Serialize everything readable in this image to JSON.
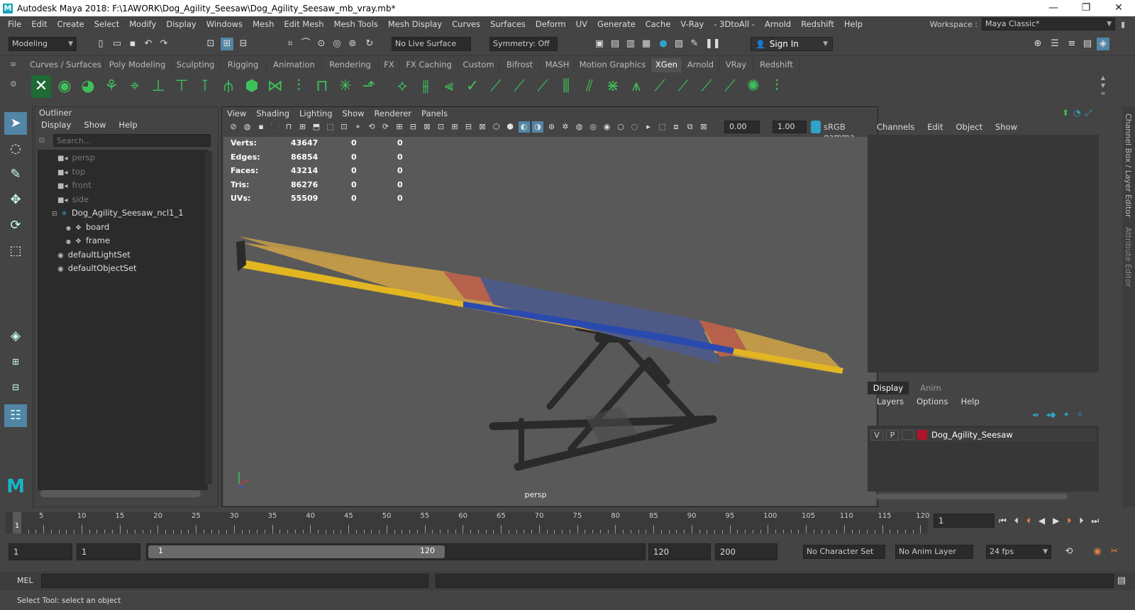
{
  "window": {
    "title": "Autodesk Maya 2018: F:\\1AWORK\\Dog_Agility_Seesaw\\Dog_Agility_Seesaw_mb_vray.mb*",
    "logo": "M",
    "minimize": "—",
    "restore": "❐",
    "close": "✕"
  },
  "menubar": {
    "items": [
      "File",
      "Edit",
      "Create",
      "Select",
      "Modify",
      "Display",
      "Windows",
      "Mesh",
      "Edit Mesh",
      "Mesh Tools",
      "Mesh Display",
      "Curves",
      "Surfaces",
      "Deform",
      "UV",
      "Generate",
      "Cache",
      "V-Ray",
      "- 3DtoAll -",
      "Arnold",
      "Redshift",
      "Help"
    ],
    "workspace_label": "Workspace :",
    "workspace_value": "Maya Classic*"
  },
  "toolbar": {
    "mode": "Modeling",
    "live_surface": "No Live Surface",
    "symmetry": "Symmetry: Off",
    "sign_in": "Sign In"
  },
  "shelf_tabs": [
    "Curves / Surfaces",
    "Poly Modeling",
    "Sculpting",
    "Rigging",
    "Animation",
    "Rendering",
    "FX",
    "FX Caching",
    "Custom",
    "Bifrost",
    "MASH",
    "Motion Graphics",
    "XGen",
    "Arnold",
    "VRay",
    "Redshift"
  ],
  "active_shelf": "XGen",
  "outliner": {
    "title": "Outliner",
    "menu": [
      "Display",
      "Show",
      "Help"
    ],
    "search_placeholder": "Search...",
    "items": [
      {
        "label": "persp",
        "dim": true
      },
      {
        "label": "top",
        "dim": true
      },
      {
        "label": "front",
        "dim": true
      },
      {
        "label": "side",
        "dim": true
      },
      {
        "label": "Dog_Agility_Seesaw_ncl1_1",
        "dim": false
      },
      {
        "label": "board",
        "dim": false
      },
      {
        "label": "frame",
        "dim": false
      },
      {
        "label": "defaultLightSet",
        "dim": false
      },
      {
        "label": "defaultObjectSet",
        "dim": false
      }
    ]
  },
  "viewport": {
    "menu": [
      "View",
      "Shading",
      "Lighting",
      "Show",
      "Renderer",
      "Panels"
    ],
    "exposure": "0.00",
    "gamma": "1.00",
    "colorspace": "sRGB gamma",
    "camera": "persp",
    "stats": [
      {
        "label": "Verts:",
        "v1": "43647",
        "v2": "0",
        "v3": "0"
      },
      {
        "label": "Edges:",
        "v1": "86854",
        "v2": "0",
        "v3": "0"
      },
      {
        "label": "Faces:",
        "v1": "43214",
        "v2": "0",
        "v3": "0"
      },
      {
        "label": "Tris:",
        "v1": "86276",
        "v2": "0",
        "v3": "0"
      },
      {
        "label": "UVs:",
        "v1": "55509",
        "v2": "0",
        "v3": "0"
      }
    ]
  },
  "channelbox": {
    "menu": [
      "Channels",
      "Edit",
      "Object",
      "Show"
    ],
    "side_tab1": "Channel Box / Layer Editor",
    "side_tab2": "Attribute Editor"
  },
  "layers": {
    "tabs": [
      "Display",
      "Anim"
    ],
    "menu": [
      "Layers",
      "Options",
      "Help"
    ],
    "layer": {
      "v": "V",
      "p": "P",
      "name": "Dog_Agility_Seesaw",
      "color": "#b0142a"
    }
  },
  "timeline": {
    "ticks": [
      "5",
      "10",
      "15",
      "20",
      "25",
      "30",
      "35",
      "40",
      "45",
      "50",
      "55",
      "60",
      "65",
      "70",
      "75",
      "80",
      "85",
      "90",
      "95",
      "100",
      "105",
      "110",
      "115",
      "120"
    ],
    "current": "1",
    "frame_field": "1"
  },
  "range": {
    "start": "1",
    "start2": "1",
    "slider_start": "1",
    "slider_end": "120",
    "end": "120",
    "end2": "200",
    "char_set": "No Character Set",
    "anim_layer": "No Anim Layer",
    "fps": "24 fps"
  },
  "cmd": {
    "label": "MEL"
  },
  "helpline": "Select Tool: select an object"
}
